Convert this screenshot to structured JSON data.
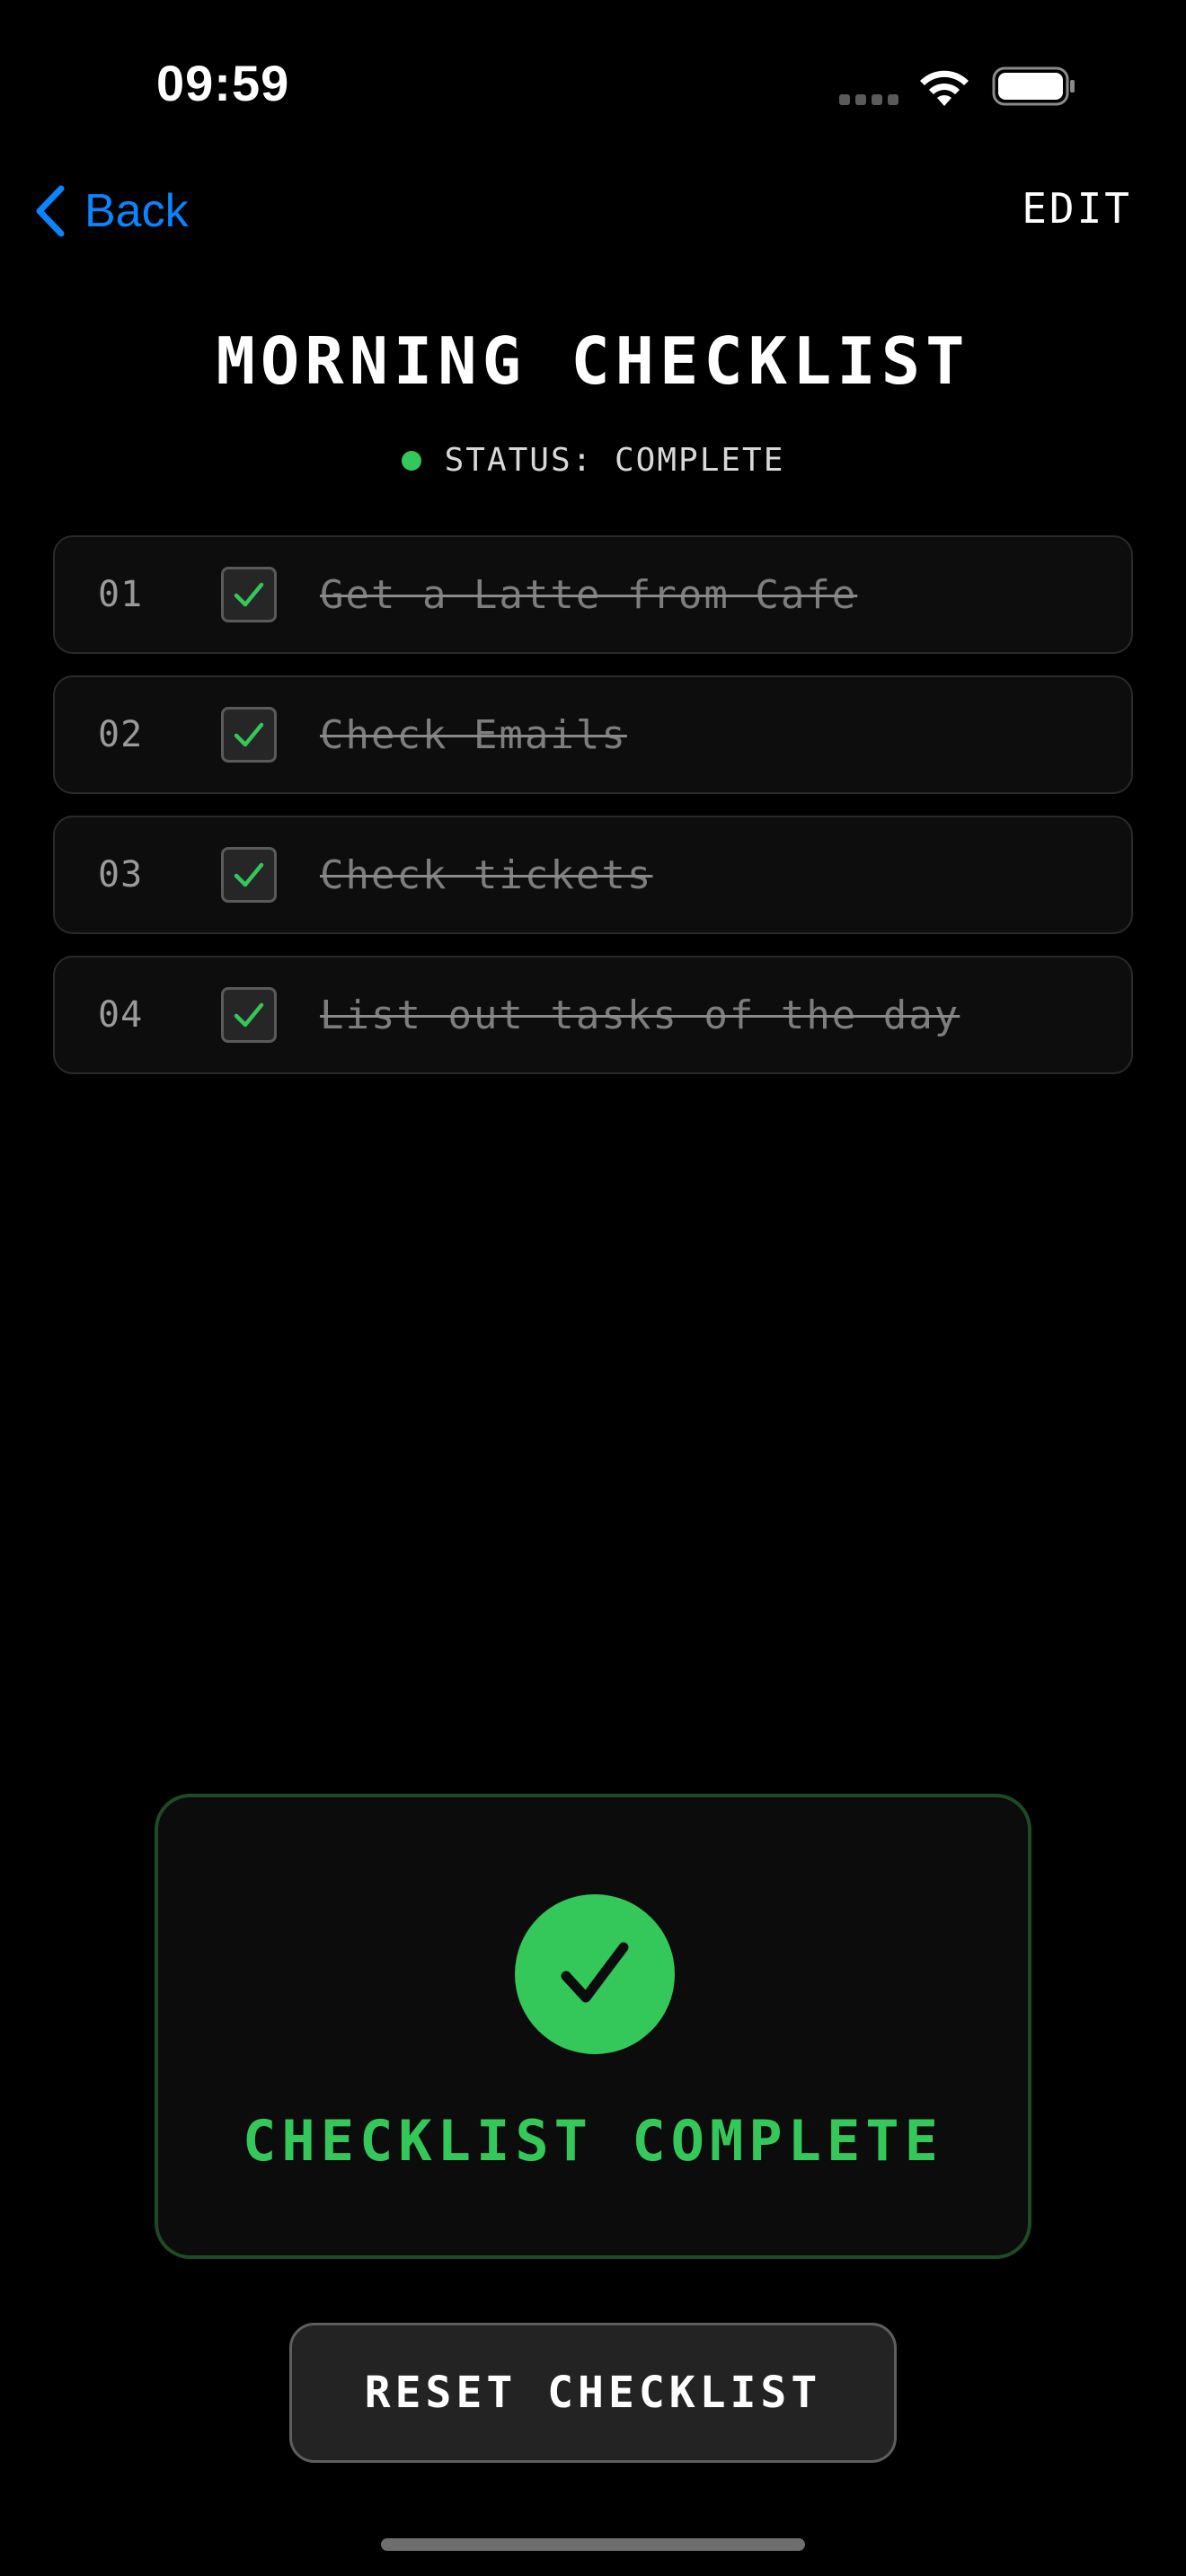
{
  "status_bar": {
    "time": "09:59"
  },
  "nav": {
    "back_label": "Back",
    "edit_label": "EDIT"
  },
  "header": {
    "title": "MORNING CHECKLIST",
    "status_text": "STATUS: COMPLETE"
  },
  "checklist": {
    "items": [
      {
        "number": "01",
        "label": "Get a Latte from Cafe",
        "checked": true
      },
      {
        "number": "02",
        "label": "Check Emails",
        "checked": true
      },
      {
        "number": "03",
        "label": "Check tickets",
        "checked": true
      },
      {
        "number": "04",
        "label": "List out tasks of the day",
        "checked": true
      }
    ]
  },
  "complete_card": {
    "label": "CHECKLIST COMPLETE"
  },
  "actions": {
    "reset_label": "RESET CHECKLIST"
  },
  "colors": {
    "background": "#000000",
    "accent_green": "#34c759",
    "link_blue": "#0a84ff"
  },
  "icons": {
    "back": "chevron-left-icon",
    "wifi": "wifi-icon",
    "battery": "battery-icon",
    "check": "checkmark-icon"
  }
}
